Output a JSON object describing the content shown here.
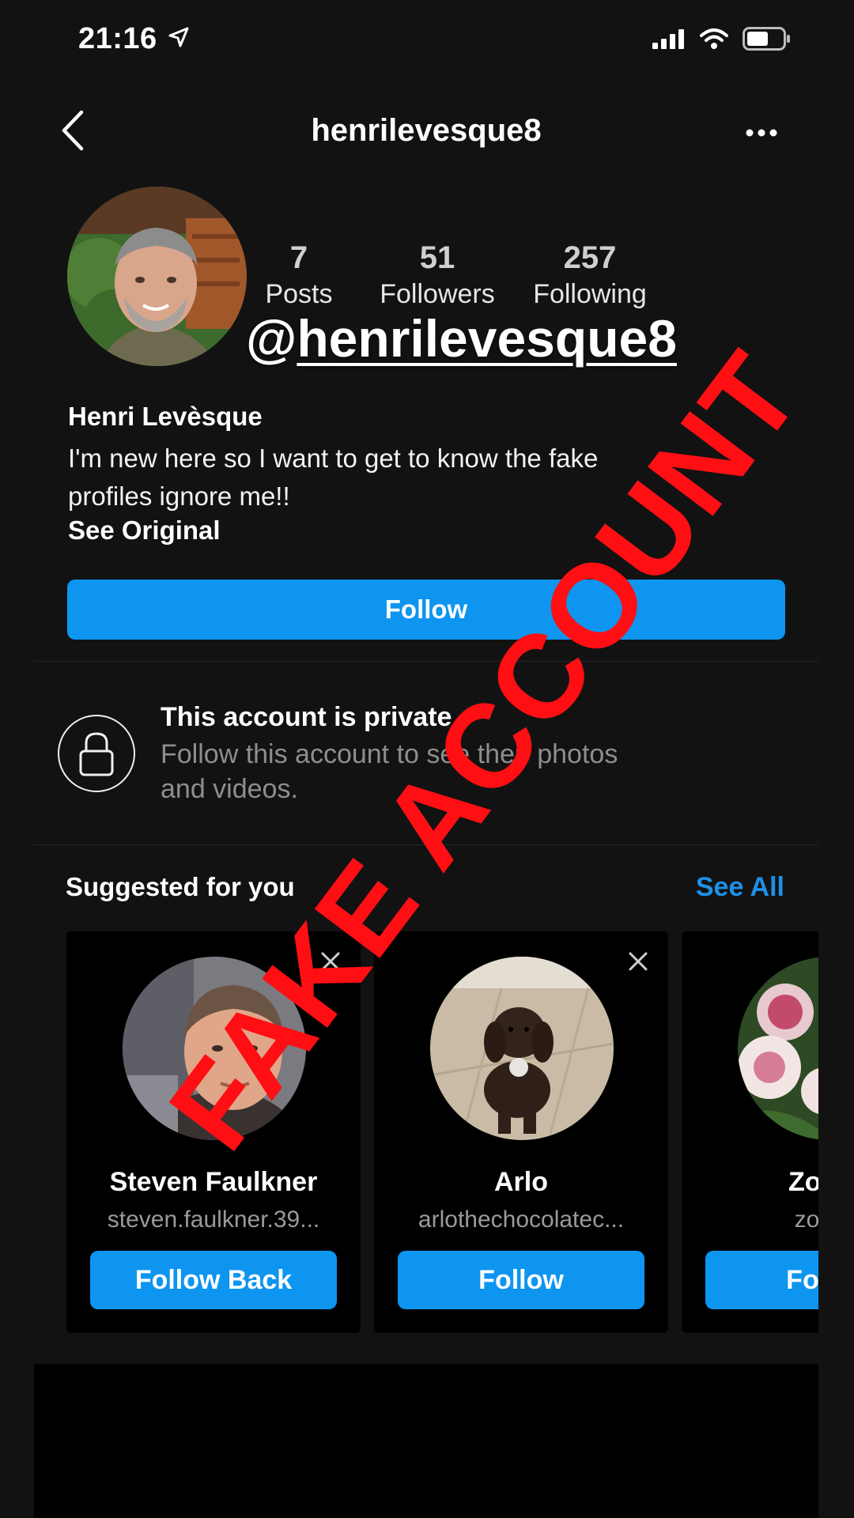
{
  "status_bar": {
    "time": "21:16"
  },
  "topbar": {
    "title": "henrilevesque8"
  },
  "profile": {
    "stats": [
      {
        "num": "7",
        "label": "Posts"
      },
      {
        "num": "51",
        "label": "Followers"
      },
      {
        "num": "257",
        "label": "Following"
      }
    ],
    "handle_overlay_at": "@",
    "handle_overlay_rest": "henrilevesque8",
    "name": "Henri Levèsque",
    "bio_line1": "I'm new here so I want to get to know the fake",
    "bio_line2": "profiles ignore me!!",
    "see_original": "See Original",
    "follow_label": "Follow"
  },
  "private_notice": {
    "title": "This account is private",
    "subtitle_line1": "Follow this account to see their photos",
    "subtitle_line2": "and videos."
  },
  "suggested": {
    "title": "Suggested for you",
    "see_all": "See All",
    "cards": [
      {
        "name": "Steven Faulkner",
        "username": "steven.faulkner.39...",
        "button": "Follow Back"
      },
      {
        "name": "Arlo",
        "username": "arlothechocolatec...",
        "button": "Follow"
      },
      {
        "name": "Zoe W",
        "username": "zoe_w",
        "button": "Follow"
      }
    ]
  },
  "overlay_stamp": "FAKE ACCOUNT",
  "colors": {
    "accent": "#0d95f0",
    "stamp": "#ff0f13",
    "background": "#121212"
  },
  "icons": [
    "location-arrow-icon",
    "signal-icon",
    "wifi-icon",
    "battery-icon",
    "back-chevron-icon",
    "more-dots-icon",
    "lock-icon",
    "close-icon"
  ]
}
